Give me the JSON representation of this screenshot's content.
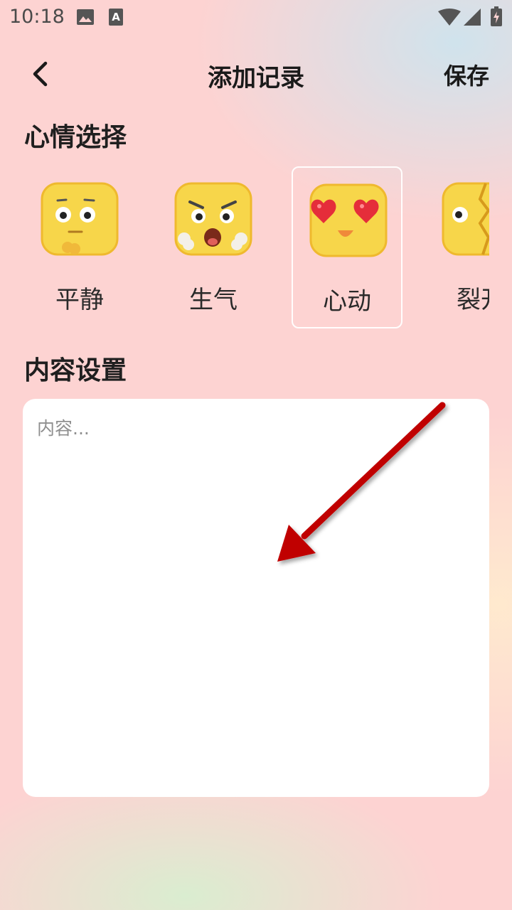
{
  "status_bar": {
    "time": "10:18",
    "icons": [
      "image-icon",
      "text-a-icon",
      "wifi-icon",
      "signal-icon",
      "battery-icon"
    ]
  },
  "header": {
    "title": "添加记录",
    "back_icon": "chevron-left-icon",
    "save_label": "保存"
  },
  "mood_section": {
    "title": "心情选择",
    "selected": "心动",
    "items": [
      {
        "label": "平静",
        "icon": "calm-emoji-icon"
      },
      {
        "label": "生气",
        "icon": "angry-emoji-icon"
      },
      {
        "label": "心动",
        "icon": "heart-eyes-emoji-icon"
      },
      {
        "label": "裂开",
        "icon": "cracked-emoji-icon"
      }
    ]
  },
  "content_section": {
    "title": "内容设置",
    "placeholder": "内容...",
    "value": ""
  },
  "overlay": {
    "arrow_icon": "red-pointer-arrow-icon",
    "color": "#c00000"
  },
  "colors": {
    "background_pink": "#fdd3d2",
    "card": "#ffffff",
    "face_yellow": "#f7d64a",
    "heart_red": "#e52d3a"
  }
}
